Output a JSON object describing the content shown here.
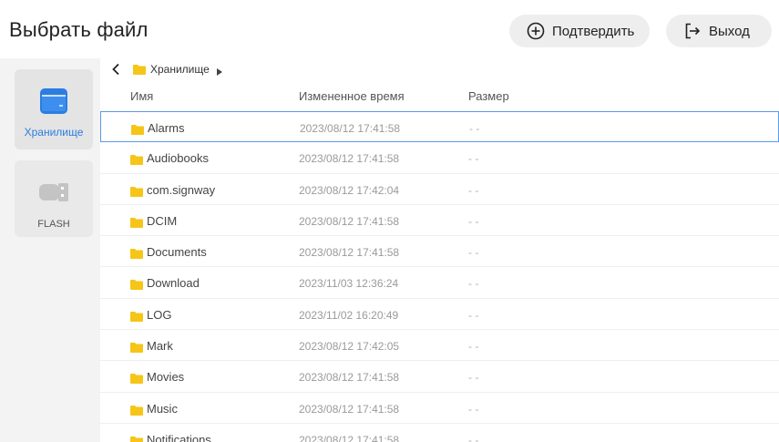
{
  "header": {
    "title": "Выбрать файл",
    "confirm_label": "Подтвердить",
    "confirm_icon": "plus-circle-icon",
    "exit_label": "Выход",
    "exit_icon": "exit-icon"
  },
  "sidebar": {
    "items": [
      {
        "label": "Хранилище",
        "icon": "storage-icon",
        "active": true
      },
      {
        "label": "FLASH",
        "icon": "usb-flash-icon",
        "active": false
      }
    ]
  },
  "breadcrumb": {
    "path": "Хранилище"
  },
  "columns": {
    "name": "Имя",
    "time": "Измененное время",
    "size": "Размер"
  },
  "files": [
    {
      "name": "Alarms",
      "time": "2023/08/12 17:41:58",
      "size": "- -",
      "selected": true
    },
    {
      "name": "Audiobooks",
      "time": "2023/08/12 17:41:58",
      "size": "- -"
    },
    {
      "name": "com.signway",
      "time": "2023/08/12 17:42:04",
      "size": "- -"
    },
    {
      "name": "DCIM",
      "time": "2023/08/12 17:41:58",
      "size": "- -"
    },
    {
      "name": "Documents",
      "time": "2023/08/12 17:41:58",
      "size": "- -"
    },
    {
      "name": "Download",
      "time": "2023/11/03 12:36:24",
      "size": "- -"
    },
    {
      "name": "LOG",
      "time": "2023/11/02 16:20:49",
      "size": "- -"
    },
    {
      "name": "Mark",
      "time": "2023/08/12 17:42:05",
      "size": "- -"
    },
    {
      "name": "Movies",
      "time": "2023/08/12 17:41:58",
      "size": "- -"
    },
    {
      "name": "Music",
      "time": "2023/08/12 17:41:58",
      "size": "- -"
    },
    {
      "name": "Notifications",
      "time": "2023/08/12 17:41:58",
      "size": "- -"
    }
  ],
  "colors": {
    "accent": "#2b7de1",
    "folder": "#f5c518",
    "selection_border": "#5a9be6"
  }
}
